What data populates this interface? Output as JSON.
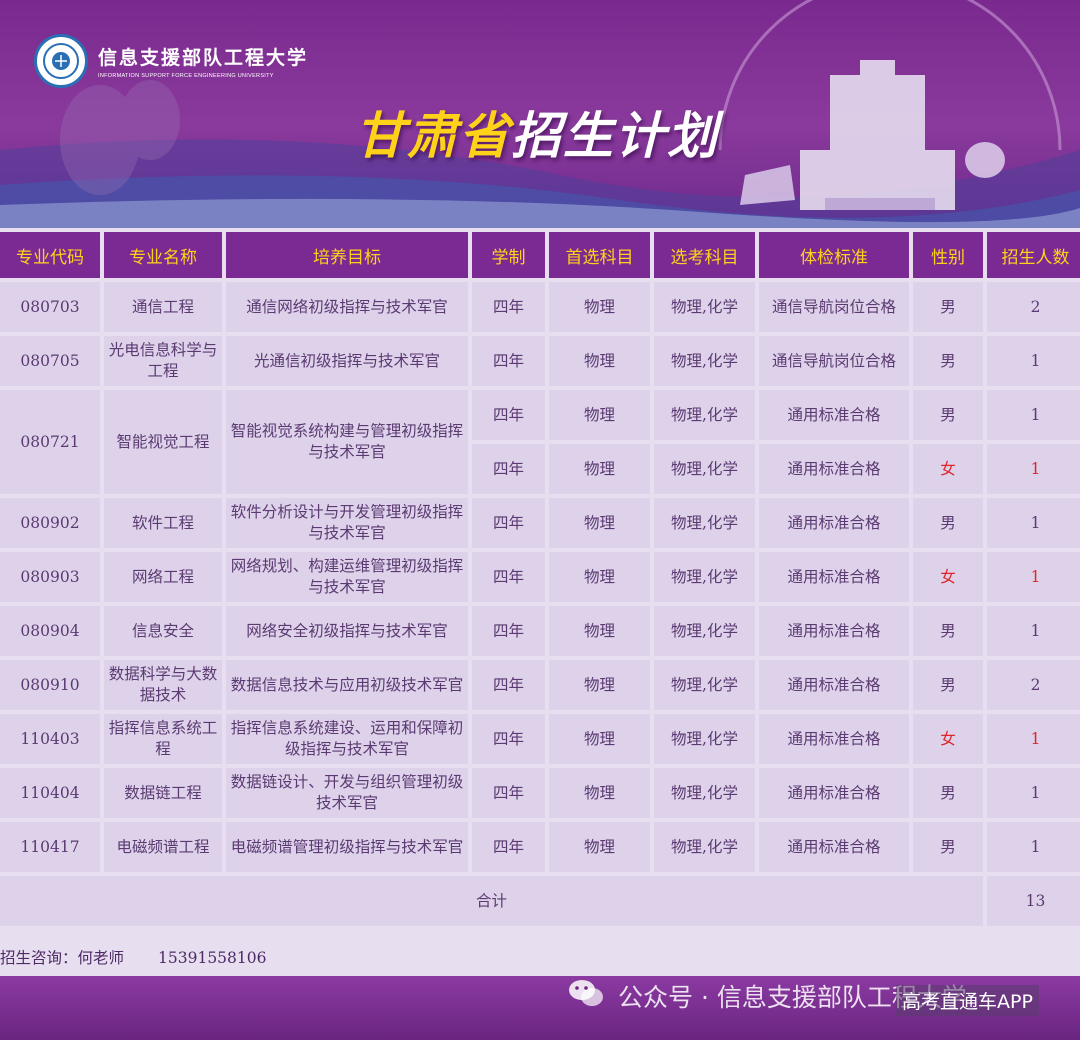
{
  "header": {
    "school_cn": "信息支援部队工程大学",
    "school_en": "INFORMATION SUPPORT FORCE ENGINEERING UNIVERSITY",
    "title_province": "甘肃省",
    "title_rest": "招生计划",
    "accent_color": "#ffd21a",
    "banner_color": "#7b2a93"
  },
  "table": {
    "headers": [
      "专业代码",
      "专业名称",
      "培养目标",
      "学制",
      "首选科目",
      "选考科目",
      "体检标准",
      "性别",
      "招生人数"
    ],
    "rows": [
      {
        "code": "080703",
        "major": "通信工程",
        "goal": "通信网络初级指挥与技术军官",
        "years": "四年",
        "first": "物理",
        "elective": "物理,化学",
        "exam": "通信导航岗位合格",
        "gender": "男",
        "count": "2"
      },
      {
        "code": "080705",
        "major": "光电信息科学与工程",
        "goal": "光通信初级指挥与技术军官",
        "years": "四年",
        "first": "物理",
        "elective": "物理,化学",
        "exam": "通信导航岗位合格",
        "gender": "男",
        "count": "1"
      },
      {
        "code": "080721",
        "major": "智能视觉工程",
        "goal": "智能视觉系统构建与管理初级指挥与技术军官",
        "years": "四年",
        "first": "物理",
        "elective": "物理,化学",
        "exam": "通用标准合格",
        "gender": "男",
        "count": "1"
      },
      {
        "years": "四年",
        "first": "物理",
        "elective": "物理,化学",
        "exam": "通用标准合格",
        "gender": "女",
        "count": "1"
      },
      {
        "code": "080902",
        "major": "软件工程",
        "goal": "软件分析设计与开发管理初级指挥与技术军官",
        "years": "四年",
        "first": "物理",
        "elective": "物理,化学",
        "exam": "通用标准合格",
        "gender": "男",
        "count": "1"
      },
      {
        "code": "080903",
        "major": "网络工程",
        "goal": "网络规划、构建运维管理初级指挥与技术军官",
        "years": "四年",
        "first": "物理",
        "elective": "物理,化学",
        "exam": "通用标准合格",
        "gender": "女",
        "count": "1"
      },
      {
        "code": "080904",
        "major": "信息安全",
        "goal": "网络安全初级指挥与技术军官",
        "years": "四年",
        "first": "物理",
        "elective": "物理,化学",
        "exam": "通用标准合格",
        "gender": "男",
        "count": "1"
      },
      {
        "code": "080910",
        "major": "数据科学与大数据技术",
        "goal": "数据信息技术与应用初级技术军官",
        "years": "四年",
        "first": "物理",
        "elective": "物理,化学",
        "exam": "通用标准合格",
        "gender": "男",
        "count": "2"
      },
      {
        "code": "110403",
        "major": "指挥信息系统工程",
        "goal": "指挥信息系统建设、运用和保障初级指挥与技术军官",
        "years": "四年",
        "first": "物理",
        "elective": "物理,化学",
        "exam": "通用标准合格",
        "gender": "女",
        "count": "1"
      },
      {
        "code": "110404",
        "major": "数据链工程",
        "goal": "数据链设计、开发与组织管理初级技术军官",
        "years": "四年",
        "first": "物理",
        "elective": "物理,化学",
        "exam": "通用标准合格",
        "gender": "男",
        "count": "1"
      },
      {
        "code": "110417",
        "major": "电磁频谱工程",
        "goal": "电磁频谱管理初级指挥与技术军官",
        "years": "四年",
        "first": "物理",
        "elective": "物理,化学",
        "exam": "通用标准合格",
        "gender": "男",
        "count": "1"
      }
    ],
    "total_label": "合计",
    "total_value": "13",
    "female_color": "#e0242a"
  },
  "consult": {
    "label": "招生咨询：何老师",
    "phone": "15391558106"
  },
  "footer": {
    "watermark": "公众号 · 信息支援部队工程大学",
    "badge": "高考直通车APP",
    "watermark_icon": "wechat-icon"
  }
}
